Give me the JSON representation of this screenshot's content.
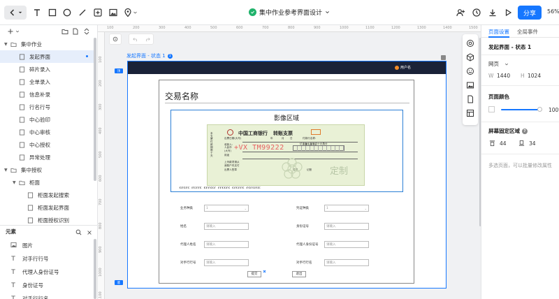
{
  "app": {
    "doc_title": "集中作业参考界面设计",
    "share_label": "分享",
    "zoom": "56%"
  },
  "left_panel": {
    "tree": [
      {
        "label": "集中作业",
        "type": "folder",
        "level": 0
      },
      {
        "label": "发起界面",
        "type": "page",
        "level": 1,
        "selected": true
      },
      {
        "label": "碎片录入",
        "type": "page",
        "level": 1
      },
      {
        "label": "全单录入",
        "type": "page",
        "level": 1
      },
      {
        "label": "信息补录",
        "type": "page",
        "level": 1
      },
      {
        "label": "行名行号",
        "type": "page",
        "level": 1
      },
      {
        "label": "中心验印",
        "type": "page",
        "level": 1
      },
      {
        "label": "中心审核",
        "type": "page",
        "level": 1
      },
      {
        "label": "中心授权",
        "type": "page",
        "level": 1
      },
      {
        "label": "异常处理",
        "type": "page",
        "level": 1
      },
      {
        "label": "集中授权",
        "type": "folder",
        "level": 0
      },
      {
        "label": "柜面",
        "type": "folder",
        "level": 1
      },
      {
        "label": "柜面发起搜索",
        "type": "page",
        "level": 2
      },
      {
        "label": "柜面发起界面",
        "type": "page",
        "level": 2
      },
      {
        "label": "柜面授权识别",
        "type": "page",
        "level": 2
      }
    ],
    "elements_title": "元素",
    "elements": [
      {
        "label": "图片",
        "glyph": "image-icon"
      },
      {
        "label": "对手行行号",
        "glyph": "text-icon"
      },
      {
        "label": "代理人身份证号",
        "glyph": "text-icon"
      },
      {
        "label": "身份证号",
        "glyph": "text-icon"
      },
      {
        "label": "对手行行名",
        "glyph": "text-icon"
      }
    ]
  },
  "canvas": {
    "frame_label": "发起界面 - 状态 1",
    "frame_badge": "1",
    "ruler_top": [
      "100",
      "200",
      "300",
      "400",
      "500",
      "600",
      "700",
      "800",
      "900",
      "1000",
      "1100",
      "1200",
      "1300",
      "1400",
      "1500"
    ],
    "ruler_left": [
      "100",
      "200",
      "300",
      "400",
      "500",
      "600",
      "700",
      "800",
      "900",
      "1000",
      "1100"
    ],
    "side_tags": [
      "顶",
      "底"
    ],
    "user_name": "用户名",
    "form": {
      "title": "交易名称",
      "image_area_title": "影像区域",
      "cheque": {
        "bank": "中国工商银行",
        "kind": "转账支票",
        "watermark": "+VX  TM99222",
        "stamp": "定制",
        "vertical_text": "本支票付款期限十天",
        "small": [
          "出票日期(大写)",
          "年",
          "月",
          "日",
          "付款行名称:",
          "收款人:",
          "出票人账号:",
          "人民币",
          "(大写)",
          "亿千百十万千百十元角分",
          "用途",
          "上列款项请从",
          "我账户内支付",
          "出票人签章",
          "复核",
          "记账"
        ],
        "micr_code": "⑆⑈⑆⑈⑆ ⑈⑆⑈⑈⑆ ⑆⑈⑈⑆⑆⑈ ⑈⑈⑆⑆⑈⑆ ⑆⑈⑆⑈⑈⑆ ⑈⑆⑈⑆⑈⑆⑆"
      },
      "fields": [
        {
          "label": "业务种类",
          "kind": "select",
          "value": "1",
          "col": 0,
          "row": 0
        },
        {
          "label": "凭证种类",
          "kind": "select",
          "value": "1",
          "col": 1,
          "row": 0
        },
        {
          "label": "姓名",
          "kind": "input",
          "placeholder": "请输入",
          "col": 0,
          "row": 1
        },
        {
          "label": "身份证号",
          "kind": "input",
          "placeholder": "请输入",
          "col": 1,
          "row": 1
        },
        {
          "label": "代理人姓名",
          "kind": "input",
          "placeholder": "请输入",
          "col": 0,
          "row": 2
        },
        {
          "label": "代理人身份证号",
          "kind": "input",
          "placeholder": "请输入",
          "col": 1,
          "row": 2
        },
        {
          "label": "对手行行号",
          "kind": "input",
          "placeholder": "请输入",
          "col": 0,
          "row": 3
        },
        {
          "label": "对手行行名",
          "kind": "input",
          "placeholder": "请输入",
          "col": 1,
          "row": 3
        }
      ],
      "submit_label": "提交",
      "cancel_label": "退出"
    }
  },
  "right_panel": {
    "tabs": [
      "页面设置",
      "全局事件"
    ],
    "title": "发起界面 - 状态 1",
    "device": "网页",
    "width_label": "W",
    "width_value": "1440",
    "height_label": "H",
    "height_value": "1024",
    "page_color_label": "页面颜色",
    "opacity": "100%",
    "fixed_label": "屏幕固定区域",
    "fixed_top": "44",
    "fixed_bottom": "34",
    "hint": "多选页面，可以批量修改属性"
  },
  "colors": {
    "accent": "#1677ff",
    "topbar": "#1a2238",
    "success": "#20b26b"
  }
}
